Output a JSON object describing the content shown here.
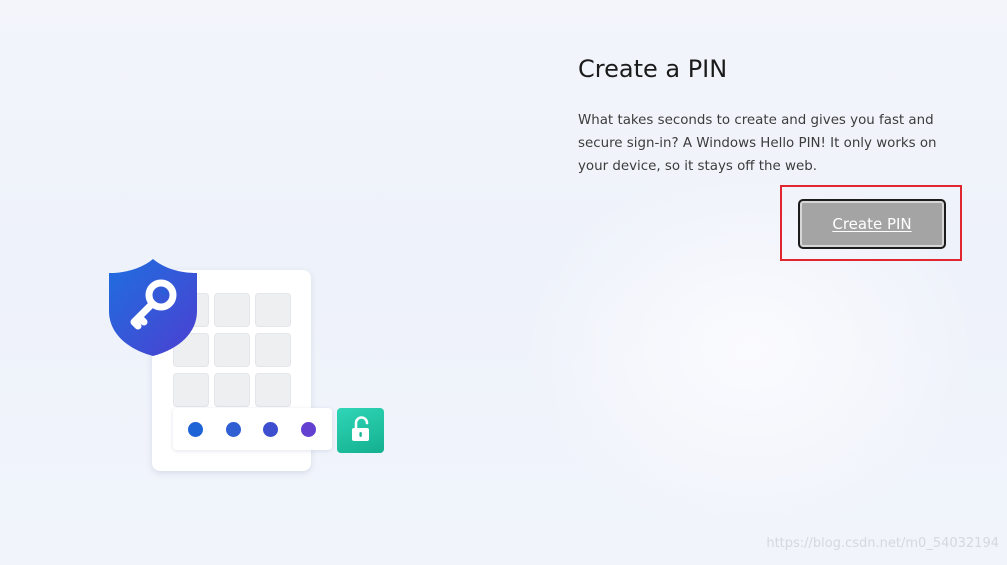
{
  "page": {
    "title": "Create a PIN",
    "description": "What takes seconds to create and gives you fast and secure sign-in? A Windows Hello PIN! It only works on your device, so it stays off the web.",
    "primary_button_label": "Create PIN"
  },
  "illustration": {
    "shield_icon": "shield-key-icon",
    "lock_icon": "unlock-icon",
    "pin_dot_colors": [
      "#1f64d6",
      "#2f5fd3",
      "#3d4fcf",
      "#6340d0"
    ],
    "shield_color": "#2266dd",
    "lock_tile_color": "#1cc4a2"
  },
  "highlight": {
    "color": "#e0262e"
  },
  "watermark": "https://blog.csdn.net/m0_54032194"
}
